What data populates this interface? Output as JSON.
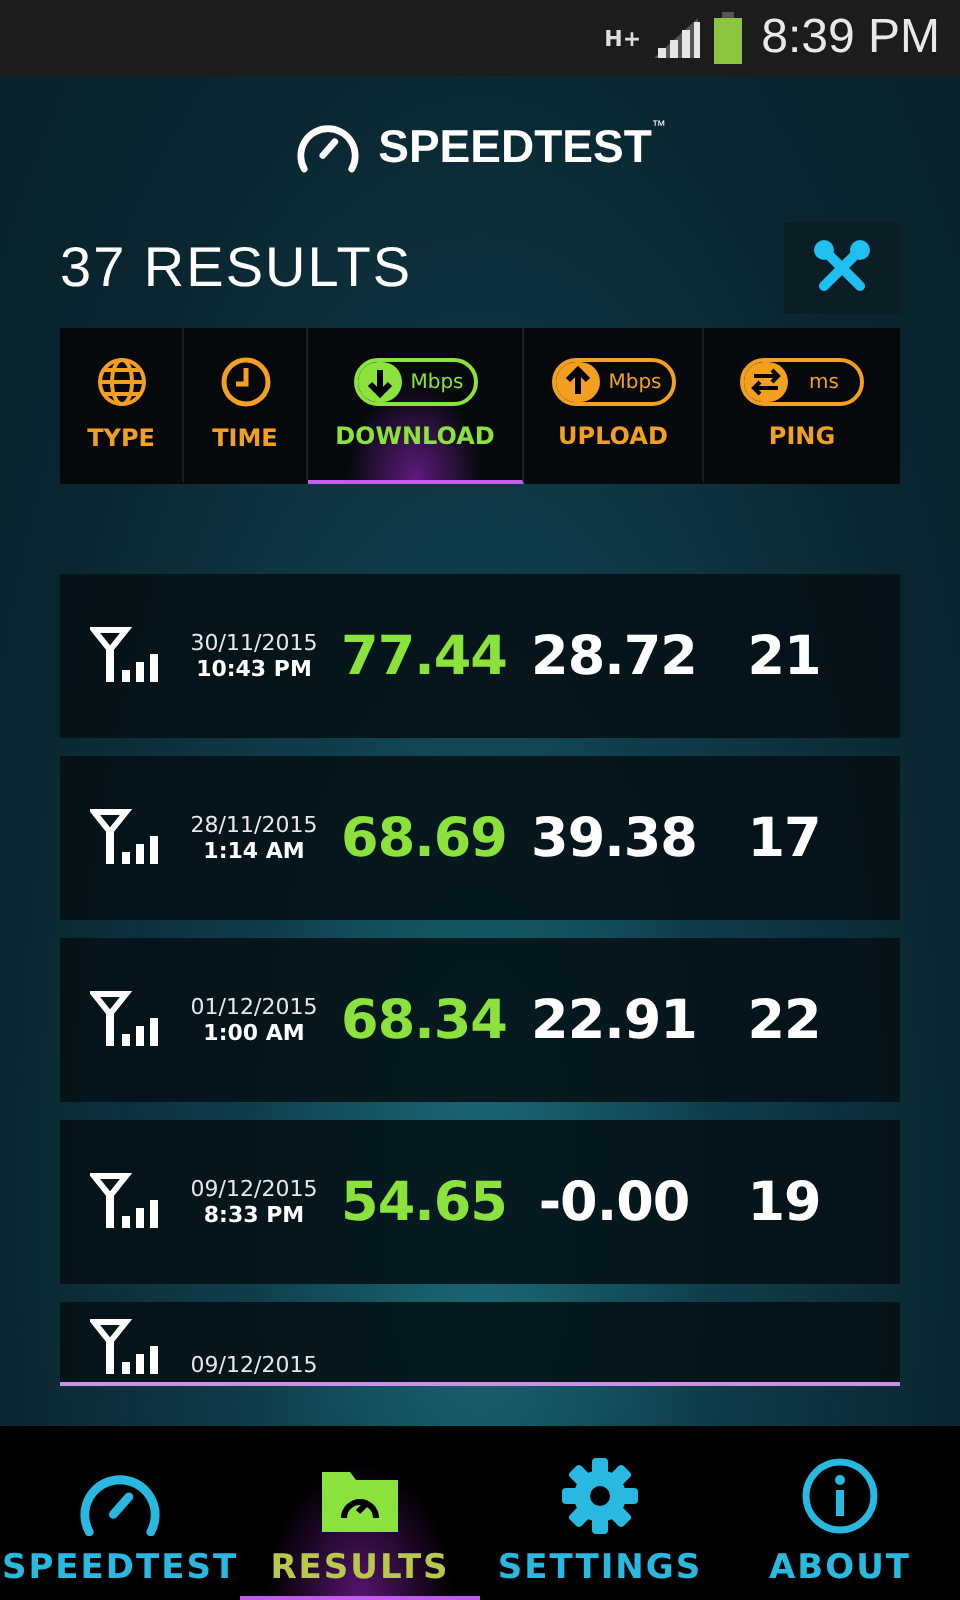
{
  "status_bar": {
    "network": "H+",
    "time": "8:39 PM"
  },
  "logo": {
    "name": "SPEEDTEST",
    "mark": "™"
  },
  "results_title": "37 RESULTS",
  "sort_tabs": [
    {
      "kind": "type",
      "label": "TYPE",
      "selected": false
    },
    {
      "kind": "time",
      "label": "TIME",
      "selected": false
    },
    {
      "kind": "download",
      "label": "DOWNLOAD",
      "unit": "Mbps",
      "selected": true
    },
    {
      "kind": "upload",
      "label": "UPLOAD",
      "unit": "Mbps",
      "selected": false
    },
    {
      "kind": "ping",
      "label": "PING",
      "unit": "ms",
      "selected": false
    }
  ],
  "results": [
    {
      "date": "30/11/2015",
      "time": "10:43 PM",
      "download": "77.44",
      "upload": "28.72",
      "ping": "21"
    },
    {
      "date": "28/11/2015",
      "time": "1:14 AM",
      "download": "68.69",
      "upload": "39.38",
      "ping": "17"
    },
    {
      "date": "01/12/2015",
      "time": "1:00 AM",
      "download": "68.34",
      "upload": "22.91",
      "ping": "22"
    },
    {
      "date": "09/12/2015",
      "time": "8:33 PM",
      "download": "54.65",
      "upload": "-0.00",
      "ping": "19"
    },
    {
      "date": "09/12/2015"
    }
  ],
  "nav": [
    {
      "kind": "speedtest",
      "label": "SPEEDTEST",
      "selected": false
    },
    {
      "kind": "results",
      "label": "RESULTS",
      "selected": true
    },
    {
      "kind": "settings",
      "label": "SETTINGS",
      "selected": false
    },
    {
      "kind": "about",
      "label": "ABOUT",
      "selected": false
    }
  ]
}
